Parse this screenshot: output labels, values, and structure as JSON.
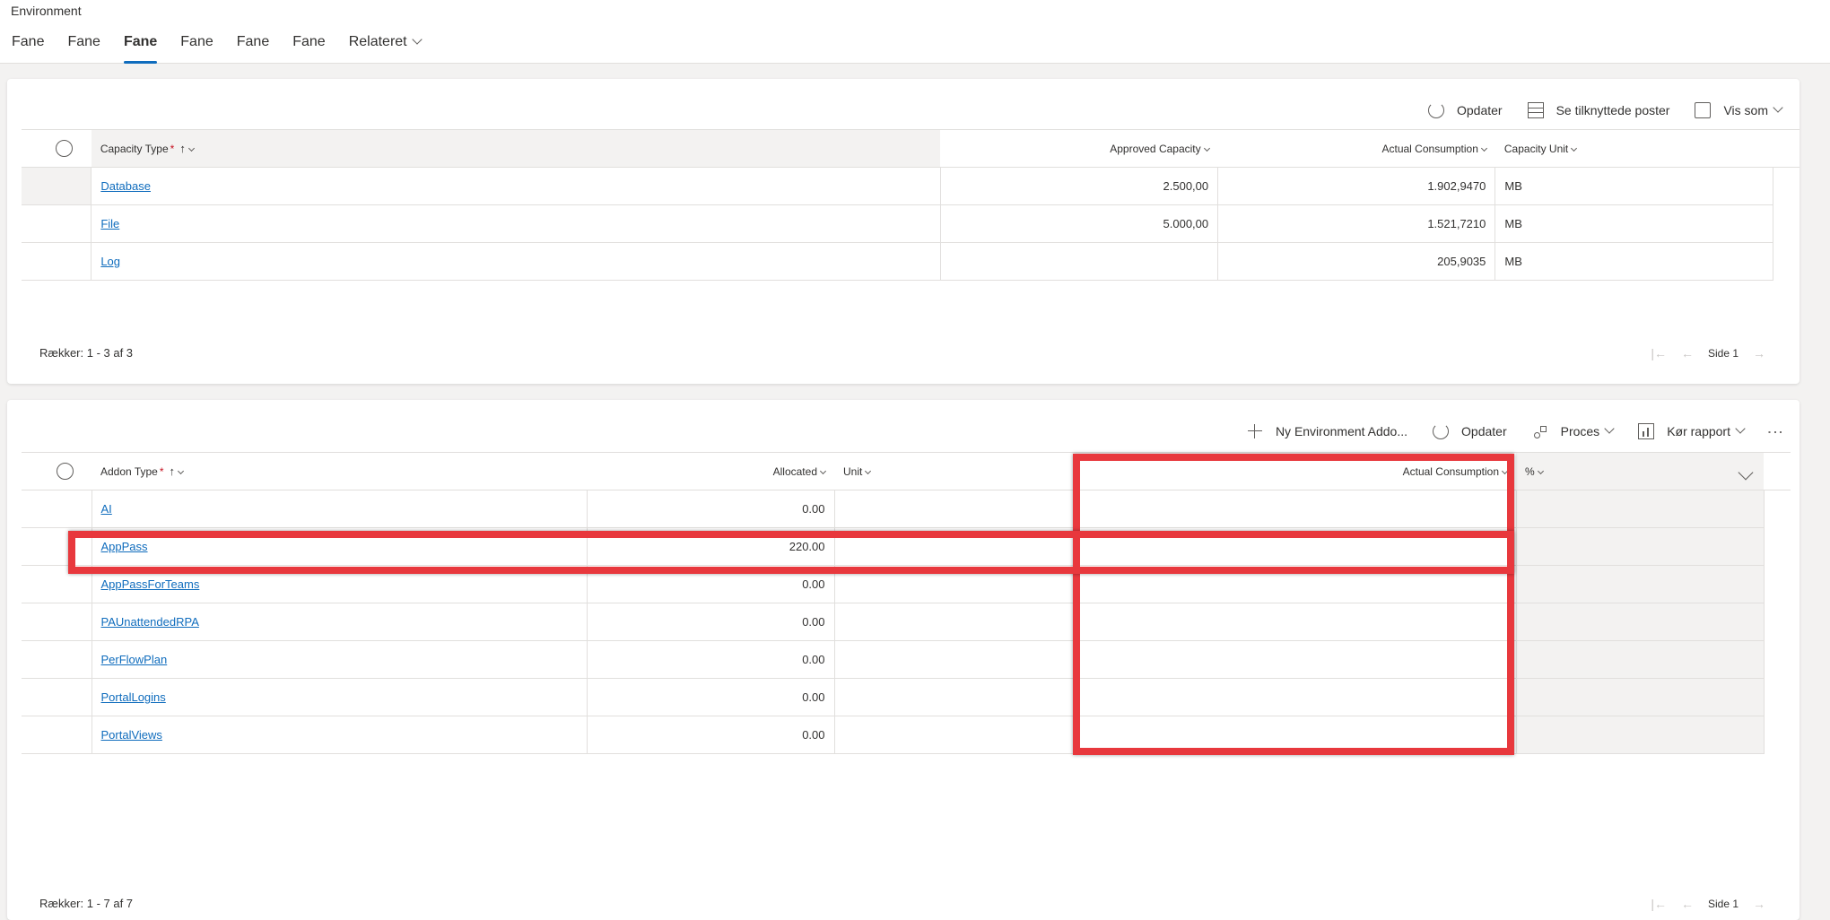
{
  "header": {
    "entity_title": "Environment",
    "tabs": [
      {
        "label": "Fane"
      },
      {
        "label": "Fane"
      },
      {
        "label": "Fane"
      },
      {
        "label": "Fane"
      },
      {
        "label": "Fane"
      },
      {
        "label": "Fane"
      },
      {
        "label": "Relateret"
      }
    ]
  },
  "capacity_grid": {
    "commands": {
      "refresh": "Opdater",
      "related": "Se tilknyttede poster",
      "view_as": "Vis som"
    },
    "columns": {
      "capacity_type": "Capacity Type",
      "approved_capacity": "Approved Capacity",
      "actual_consumption": "Actual Consumption",
      "capacity_unit": "Capacity Unit"
    },
    "required_mark": "*",
    "sort_arrow": "↑",
    "rows": [
      {
        "type": "Database",
        "approved": "2.500,00",
        "actual": "1.902,9470",
        "unit": "MB"
      },
      {
        "type": "File",
        "approved": "5.000,00",
        "actual": "1.521,7210",
        "unit": "MB"
      },
      {
        "type": "Log",
        "approved": "",
        "actual": "205,9035",
        "unit": "MB"
      }
    ],
    "footer": "Rækker: 1 - 3 af 3",
    "page_label": "Side 1"
  },
  "addon_grid": {
    "commands": {
      "new": "Ny Environment Addo...",
      "refresh": "Opdater",
      "process": "Proces",
      "report": "Kør rapport"
    },
    "columns": {
      "addon_type": "Addon Type",
      "allocated": "Allocated",
      "unit": "Unit",
      "actual_consumption": "Actual Consumption",
      "percent": "%"
    },
    "required_mark": "*",
    "sort_arrow": "↑",
    "rows": [
      {
        "type": "AI",
        "allocated": "0.00",
        "unit": "",
        "actual": "",
        "pct": ""
      },
      {
        "type": "AppPass",
        "allocated": "220.00",
        "unit": "",
        "actual": "",
        "pct": ""
      },
      {
        "type": "AppPassForTeams",
        "allocated": "0.00",
        "unit": "",
        "actual": "",
        "pct": ""
      },
      {
        "type": "PAUnattendedRPA",
        "allocated": "0.00",
        "unit": "",
        "actual": "",
        "pct": ""
      },
      {
        "type": "PerFlowPlan",
        "allocated": "0.00",
        "unit": "",
        "actual": "",
        "pct": ""
      },
      {
        "type": "PortalLogins",
        "allocated": "0.00",
        "unit": "",
        "actual": "",
        "pct": ""
      },
      {
        "type": "PortalViews",
        "allocated": "0.00",
        "unit": "",
        "actual": "",
        "pct": ""
      }
    ],
    "footer": "Rækker: 1 - 7 af 7",
    "page_label": "Side 1"
  },
  "colors": {
    "highlight": "#e8383d",
    "link": "#0f6cbd",
    "tab_underline": "#0f6cbd"
  }
}
